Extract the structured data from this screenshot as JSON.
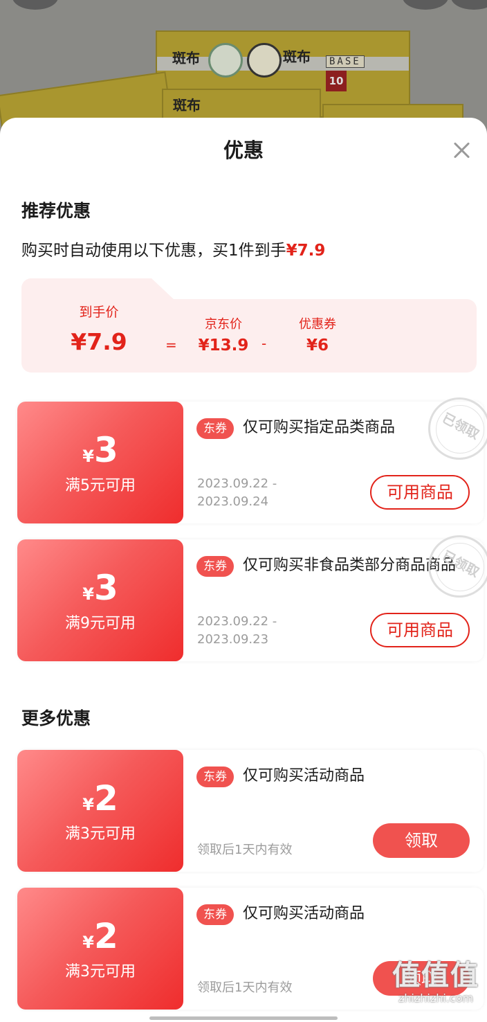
{
  "backdrop": {
    "product_brand": "斑布",
    "product_label": "BASE",
    "product_count": "10"
  },
  "sheet": {
    "title": "优惠",
    "close_icon": "close-icon"
  },
  "recommended": {
    "section_title": "推荐优惠",
    "summary_prefix": "购买时自动使用以下优惠，买1件到手",
    "summary_price": "¥7.9",
    "breakdown": {
      "final_label": "到手价",
      "final_value": "¥7.9",
      "equals": "=",
      "jd_label": "京东价",
      "jd_value": "¥13.9",
      "minus": "-",
      "coupon_label": "优惠券",
      "coupon_value": "¥6"
    }
  },
  "coupons": [
    {
      "yen": "¥",
      "amount": "3",
      "condition": "满5元可用",
      "tag": "东券",
      "description": "仅可购买指定品类商品",
      "valid_from": "2023.09.22 -",
      "valid_to": "2023.09.24",
      "button": "可用商品",
      "stamp": "已领取"
    },
    {
      "yen": "¥",
      "amount": "3",
      "condition": "满9元可用",
      "tag": "东券",
      "description": "仅可购买非食品类部分商品商品",
      "valid_from": "2023.09.22 -",
      "valid_to": "2023.09.23",
      "button": "可用商品",
      "stamp": "已领取"
    }
  ],
  "more": {
    "section_title": "更多优惠",
    "coupons": [
      {
        "yen": "¥",
        "amount": "2",
        "condition": "满3元可用",
        "tag": "东券",
        "description": "仅可购买活动商品",
        "validity": "领取后1天内有效",
        "button": "领取"
      },
      {
        "yen": "¥",
        "amount": "2",
        "condition": "满3元可用",
        "tag": "东券",
        "description": "仅可购买活动商品",
        "validity": "领取后1天内有效",
        "button": "领取"
      }
    ]
  },
  "watermark": {
    "big": "值值值",
    "small": "zhizhizhi.com"
  },
  "colors": {
    "accent": "#e2231a",
    "tag": "#f0524f",
    "price_card_bg": "#fdeeee"
  }
}
